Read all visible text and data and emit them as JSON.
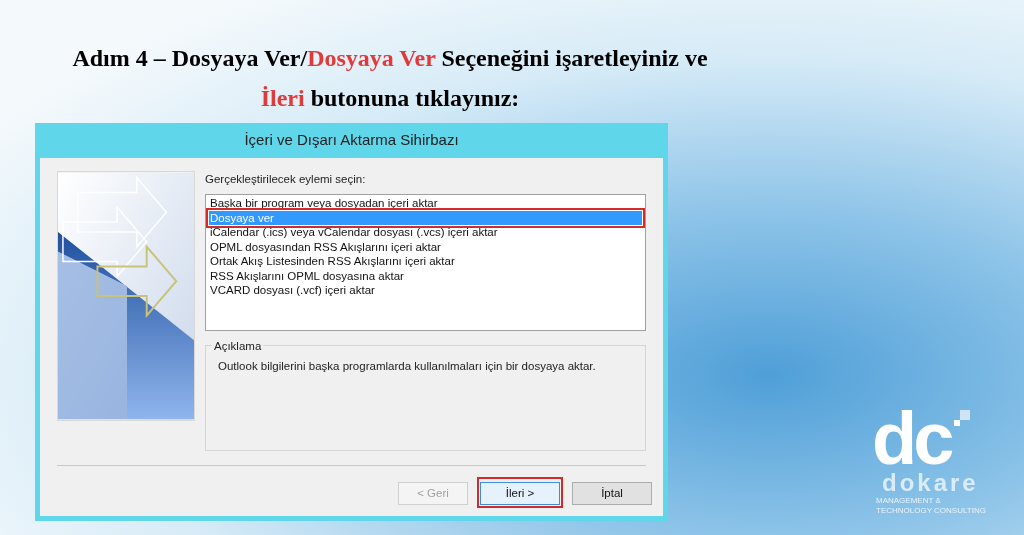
{
  "heading": {
    "lines": [
      [
        {
          "text": "Adım 4 – Dosyaya Ver/",
          "highlight": false
        },
        {
          "text": "Dosyaya Ver",
          "highlight": true
        },
        {
          "text": " Seçeneğini işaretleyiniz ve",
          "highlight": false
        }
      ],
      [
        {
          "text": "İleri",
          "highlight": true
        },
        {
          "text": " butonuna tıklayınız:",
          "highlight": false
        }
      ]
    ]
  },
  "dialog": {
    "title": "İçeri ve Dışarı Aktarma Sihirbazı",
    "prompt": "Gerçekleştirilecek eylemi seçin:",
    "actions": [
      {
        "label": "Başka bir program veya dosyadan içeri aktar",
        "selected": false,
        "highlighted": false
      },
      {
        "label": "Dosyaya ver",
        "selected": true,
        "highlighted": true
      },
      {
        "label": "iCalendar (.ics) veya vCalendar dosyası (.vcs) içeri aktar",
        "selected": false,
        "highlighted": false
      },
      {
        "label": "OPML dosyasından RSS Akışlarını içeri aktar",
        "selected": false,
        "highlighted": false
      },
      {
        "label": "Ortak Akış Listesinden RSS Akışlarını içeri aktar",
        "selected": false,
        "highlighted": false
      },
      {
        "label": "RSS Akışlarını OPML dosyasına aktar",
        "selected": false,
        "highlighted": false
      },
      {
        "label": "VCARD dosyası (.vcf) içeri aktar",
        "selected": false,
        "highlighted": false
      }
    ],
    "description": {
      "legend": "Açıklama",
      "text": "Outlook bilgilerini başka programlarda kullanılmaları için bir dosyaya aktar."
    },
    "buttons": [
      {
        "label": "< Geri",
        "disabled": true,
        "highlighted": false,
        "focused": false
      },
      {
        "label": "İleri >",
        "disabled": false,
        "highlighted": true,
        "focused": true
      },
      {
        "label": "İptal",
        "disabled": false,
        "highlighted": false,
        "focused": false
      }
    ]
  },
  "logo": {
    "mark": "dc",
    "name": "dokare",
    "tagline": [
      "MANAGEMENT &",
      "TECHNOLOGY CONSULTING"
    ]
  }
}
